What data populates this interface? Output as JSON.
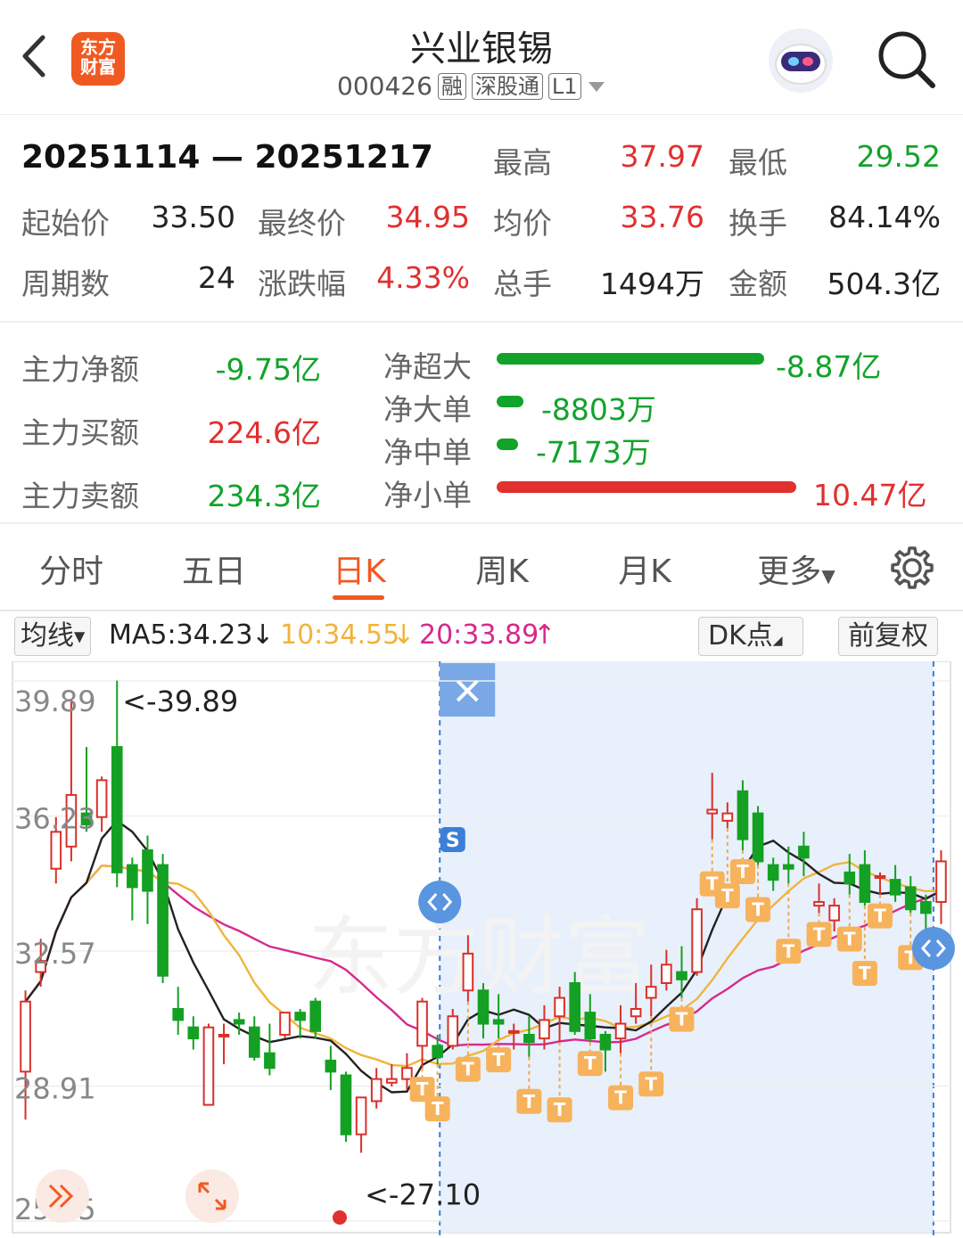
{
  "header": {
    "title": "兴业银锡",
    "code": "000426",
    "tags": [
      "融",
      "深股通",
      "L1"
    ],
    "logo_text": "东方财富"
  },
  "stats": {
    "date_range": "20251114 — 20251217",
    "high_label": "最高",
    "high": "37.97",
    "low_label": "最低",
    "low": "29.52",
    "start_label": "起始价",
    "start": "33.50",
    "end_label": "最终价",
    "end": "34.95",
    "avg_label": "均价",
    "avg": "33.76",
    "turnover_label": "换手",
    "turnover": "84.14%",
    "periods_label": "周期数",
    "periods": "24",
    "change_label": "涨跌幅",
    "change": "4.33%",
    "volume_label": "总手",
    "volume": "1494万",
    "amount_label": "金额",
    "amount": "504.3亿"
  },
  "fund_flow": {
    "main_net_label": "主力净额",
    "main_net": "-9.75亿",
    "main_buy_label": "主力买额",
    "main_buy": "224.6亿",
    "main_sell_label": "主力卖额",
    "main_sell": "234.3亿",
    "rows": [
      {
        "label": "净超大",
        "value": "-8.87亿",
        "color": "#12a32a",
        "magnitude": 8.87
      },
      {
        "label": "净大单",
        "value": "-8803万",
        "color": "#12a32a",
        "magnitude": 0.88
      },
      {
        "label": "净中单",
        "value": "-7173万",
        "color": "#12a32a",
        "magnitude": 0.72
      },
      {
        "label": "净小单",
        "value": "10.47亿",
        "color": "#e0302f",
        "magnitude": 10.47
      }
    ]
  },
  "tabs": [
    "分时",
    "五日",
    "日K",
    "周K",
    "月K",
    "更多"
  ],
  "active_tab": "日K",
  "ma_bar": {
    "mode": "均线",
    "ma5": "MA5:34.23",
    "ma10": "10:34.55",
    "ma20": "20:33.89",
    "dk_label": "DK点",
    "adjust_label": "前复权"
  },
  "chart_data": {
    "type": "candlestick",
    "y_ticks": [
      "39.89",
      "36.23",
      "32.57",
      "28.91",
      "25.25"
    ],
    "ylim": [
      25.25,
      39.89
    ],
    "max_label": "<-39.89",
    "min_label": "<-27.10",
    "colors": {
      "up": "#d9302a",
      "down": "#14a022",
      "ma5": "#222222",
      "ma10": "#f0b43c",
      "ma20": "#d62a8c"
    },
    "candles": [
      [
        29.3,
        31.2,
        28.0,
        31.5
      ],
      [
        32.0,
        32.3,
        31.6,
        32.9
      ],
      [
        34.8,
        35.8,
        34.4,
        36.2
      ],
      [
        35.4,
        36.8,
        35.0,
        39.4
      ],
      [
        36.3,
        36.0,
        35.8,
        38.1
      ],
      [
        36.2,
        37.2,
        35.8,
        37.3
      ],
      [
        38.1,
        34.7,
        34.3,
        39.9
      ],
      [
        34.9,
        34.3,
        33.4,
        35.1
      ],
      [
        35.3,
        34.2,
        33.3,
        35.7
      ],
      [
        34.9,
        31.9,
        31.7,
        35.2
      ],
      [
        31.0,
        30.7,
        30.3,
        31.6
      ],
      [
        30.5,
        30.2,
        29.9,
        30.8
      ],
      [
        28.4,
        30.5,
        28.4,
        30.6
      ],
      [
        30.3,
        30.3,
        29.5,
        30.6
      ],
      [
        30.7,
        30.6,
        30.3,
        30.9
      ],
      [
        30.5,
        29.7,
        29.6,
        30.8
      ],
      [
        29.8,
        29.4,
        29.2,
        30.6
      ],
      [
        30.3,
        30.9,
        30.2,
        30.9
      ],
      [
        30.9,
        30.7,
        30.2,
        31.0
      ],
      [
        31.2,
        30.4,
        30.2,
        31.3
      ],
      [
        29.6,
        29.3,
        28.8,
        30.0
      ],
      [
        29.2,
        27.6,
        27.4,
        29.3
      ],
      [
        27.6,
        28.6,
        27.1,
        28.6
      ],
      [
        28.5,
        29.1,
        28.3,
        29.4
      ],
      [
        29.0,
        29.1,
        28.9,
        29.5
      ],
      [
        29.1,
        29.4,
        28.8,
        29.8
      ],
      [
        30.0,
        31.2,
        29.4,
        31.3
      ],
      [
        30.0,
        29.7,
        29.5,
        30.3
      ],
      [
        30.0,
        30.8,
        29.9,
        31.0
      ],
      [
        31.5,
        32.5,
        31.2,
        33.0
      ],
      [
        31.5,
        30.6,
        30.2,
        31.7
      ],
      [
        30.7,
        30.6,
        30.2,
        31.4
      ],
      [
        30.4,
        30.4,
        29.9,
        30.6
      ],
      [
        30.3,
        30.1,
        29.7,
        30.8
      ],
      [
        30.2,
        30.7,
        29.9,
        31.1
      ],
      [
        30.8,
        31.3,
        30.1,
        31.6
      ],
      [
        31.7,
        30.4,
        30.3,
        32.0
      ],
      [
        30.9,
        30.2,
        30.1,
        31.4
      ],
      [
        30.3,
        29.9,
        29.3,
        30.4
      ],
      [
        30.2,
        30.6,
        29.8,
        31.1
      ],
      [
        30.8,
        31.0,
        30.6,
        31.7
      ],
      [
        31.3,
        31.6,
        30.8,
        32.2
      ],
      [
        31.7,
        32.2,
        31.5,
        32.6
      ],
      [
        32.0,
        31.8,
        31.3,
        32.7
      ],
      [
        32.0,
        33.7,
        31.9,
        34.0
      ],
      [
        36.3,
        36.4,
        35.6,
        37.4
      ],
      [
        36.1,
        36.3,
        35.9,
        36.6
      ],
      [
        36.9,
        35.6,
        35.3,
        37.2
      ],
      [
        36.3,
        35.0,
        34.9,
        36.5
      ],
      [
        34.9,
        34.5,
        34.2,
        35.1
      ],
      [
        34.9,
        34.8,
        34.4,
        35.4
      ],
      [
        35.4,
        35.1,
        34.6,
        35.8
      ],
      [
        33.8,
        33.9,
        33.6,
        34.4
      ],
      [
        33.4,
        33.8,
        33.1,
        34.0
      ],
      [
        34.7,
        34.4,
        34.1,
        35.2
      ],
      [
        34.9,
        33.9,
        33.8,
        35.3
      ],
      [
        34.6,
        34.6,
        34.1,
        34.7
      ],
      [
        34.5,
        34.1,
        33.9,
        34.9
      ],
      [
        34.3,
        33.7,
        33.6,
        34.6
      ],
      [
        33.9,
        33.6,
        33.1,
        34.1
      ],
      [
        33.9,
        35.0,
        33.3,
        35.3
      ]
    ],
    "selection_range": [
      28,
      59
    ]
  }
}
